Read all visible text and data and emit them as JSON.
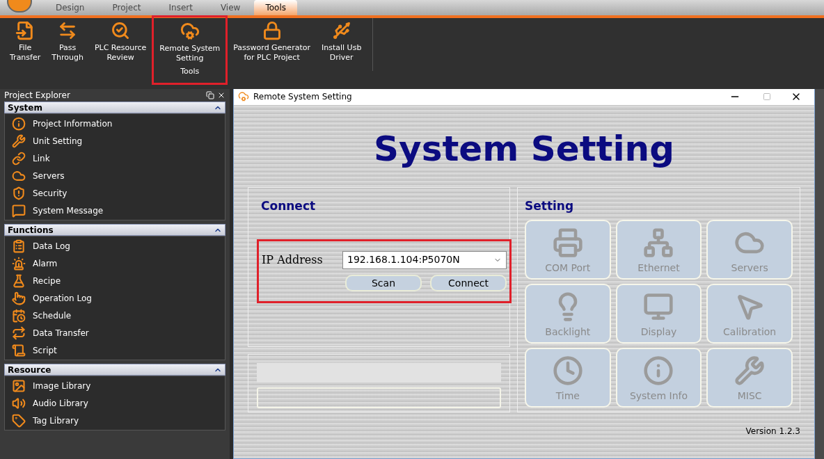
{
  "tabs": [
    {
      "label": "Design",
      "selected": false
    },
    {
      "label": "Project",
      "selected": false
    },
    {
      "label": "Insert",
      "selected": false
    },
    {
      "label": "View",
      "selected": false
    },
    {
      "label": "Tools",
      "selected": true
    }
  ],
  "ribbon": {
    "group_label": "Tools",
    "buttons": [
      {
        "lines": [
          "File",
          "Transfer"
        ],
        "highlighted": false
      },
      {
        "lines": [
          "Pass",
          "Through"
        ],
        "highlighted": false
      },
      {
        "lines": [
          "PLC Resource",
          "Review"
        ],
        "highlighted": false
      },
      {
        "lines": [
          "Remote System",
          "Setting"
        ],
        "highlighted": true
      },
      {
        "lines": [
          "Password Generator",
          "for PLC Project"
        ],
        "highlighted": false
      },
      {
        "lines": [
          "Install Usb",
          "Driver"
        ],
        "highlighted": false
      }
    ]
  },
  "explorer": {
    "title": "Project Explorer",
    "sections": [
      {
        "title": "System",
        "expanded": true,
        "items": [
          "Project Information",
          "Unit Setting",
          "Link",
          "Servers",
          "Security",
          "System Message"
        ]
      },
      {
        "title": "Functions",
        "expanded": true,
        "items": [
          "Data Log",
          "Alarm",
          "Recipe",
          "Operation Log",
          "Schedule",
          "Data Transfer",
          "Script"
        ]
      },
      {
        "title": "Resource",
        "expanded": true,
        "items": [
          "Image Library",
          "Audio Library",
          "Tag Library"
        ]
      }
    ]
  },
  "dialog": {
    "title": "Remote System Setting",
    "heading": "System Setting",
    "connect": {
      "title": "Connect",
      "highlighted": true,
      "ip_label": "IP Address",
      "ip_value": "192.168.1.104:P5070N",
      "buttons": [
        "Scan",
        "Connect"
      ]
    },
    "setting": {
      "title": "Setting",
      "tiles": [
        "COM Port",
        "Ethernet",
        "Servers",
        "Backlight",
        "Display",
        "Calibration",
        "Time",
        "System Info",
        "MISC"
      ]
    },
    "version": "Version 1.2.3"
  }
}
